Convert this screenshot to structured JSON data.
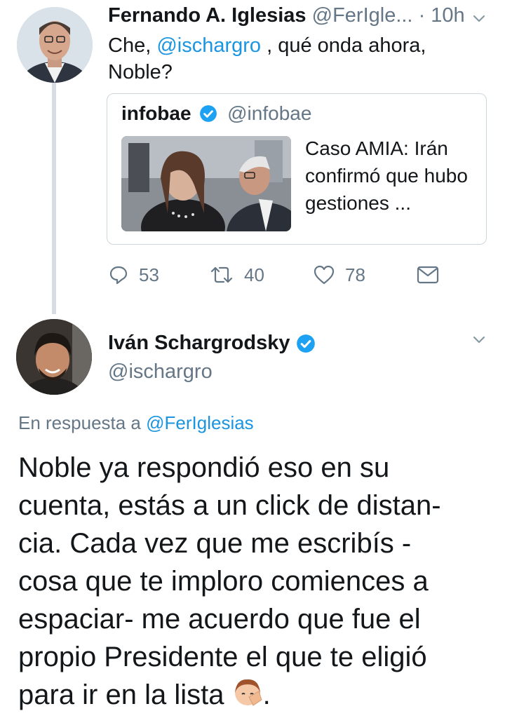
{
  "tweet1": {
    "name": "Fernando A. Iglesias",
    "handle": "@FerIgle...",
    "separator": "·",
    "time": "10h",
    "text_prefix": "Che, ",
    "mention": "@ischargro",
    "text_suffix": " , qué onda ahora, Noble?",
    "quote": {
      "name": "infobae",
      "handle": "@infobae",
      "text": "Caso AMIA: Irán confirmó que hubo gestiones ..."
    },
    "actions": {
      "replies": "53",
      "retweets": "40",
      "likes": "78"
    }
  },
  "tweet2": {
    "name": "Iván Schargrodsky",
    "handle": "@ischargro",
    "reply_prefix": "En respuesta a ",
    "reply_to": "@FerIglesias",
    "text_line1": "Noble ya respondió eso en su",
    "text_line2": "cuenta, estás a un click de distan-",
    "text_line3": "cia. Cada vez que me escribís -",
    "text_line4": "cosa que te imploro comiences a",
    "text_line5": "espaciar- me acuerdo que fue el",
    "text_line6": "propio Presidente el que te eligió",
    "text_line7": "para ir en la lista ",
    "text_end": "."
  },
  "colors": {
    "link": "#1b95e0",
    "secondary": "#657786",
    "verified": "#1da1f2",
    "border": "#ccd6dd",
    "thread_line": "#d7dde2"
  },
  "icons": [
    "verified-badge-icon",
    "chevron-down-icon",
    "reply-icon",
    "retweet-icon",
    "like-icon",
    "direct-message-icon",
    "facepalm-emoji-icon"
  ]
}
